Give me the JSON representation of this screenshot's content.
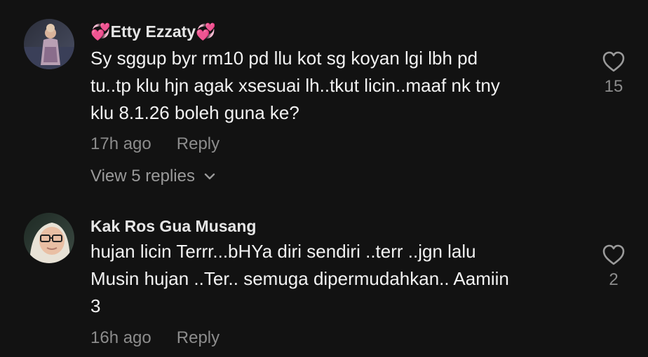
{
  "comments": [
    {
      "username": "Etty Ezzaty",
      "username_prefix_emoji": "💞",
      "username_suffix_emoji": "💞",
      "avatar": "avatar-girl-photo",
      "text_lines": [
        "Sy sggup byr rm10 pd llu kot sg koyan lgi lbh pd",
        "tu..tp klu hjn agak xsesuai lh..tkut licin..maaf nk tny",
        "klu 8.1.26 boleh guna ke?"
      ],
      "time": "17h ago",
      "reply_label": "Reply",
      "view_replies_label": "View 5 replies",
      "like_icon": "heart-outline-icon",
      "like_count": "15"
    },
    {
      "username": "Kak Ros Gua Musang",
      "avatar": "avatar-woman-glasses-photo",
      "text_lines": [
        "hujan licin Terrr...bHYa diri sendiri ..terr ..jgn lalu",
        "Musin hujan ..Ter.. semuga dipermudahkan.. Aamiin",
        "3"
      ],
      "time": "16h ago",
      "reply_label": "Reply",
      "like_icon": "heart-outline-icon",
      "like_count": "2"
    }
  ],
  "colors": {
    "background": "#121212",
    "text": "#f2f2f2",
    "muted": "#8c8c8c",
    "username": "#e6e6e6",
    "emoji_heart": "#e85d9b"
  }
}
